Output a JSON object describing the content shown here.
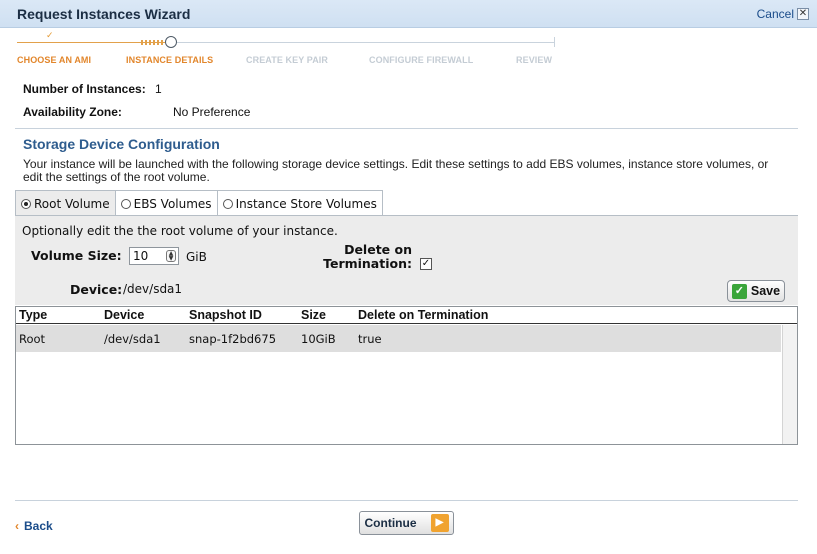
{
  "window": {
    "title": "Request Instances Wizard",
    "cancel_label": "Cancel",
    "cancel_icon": "close-icon"
  },
  "steps": [
    {
      "label": "CHOOSE AN AMI",
      "state": "done"
    },
    {
      "label": "INSTANCE DETAILS",
      "state": "active"
    },
    {
      "label": "CREATE KEY PAIR",
      "state": "pending"
    },
    {
      "label": "CONFIGURE FIREWALL",
      "state": "pending"
    },
    {
      "label": "REVIEW",
      "state": "pending"
    }
  ],
  "instance": {
    "count_label": "Number of Instances:",
    "count_value": "1",
    "zone_label": "Availability Zone:",
    "zone_value": "No Preference"
  },
  "storage": {
    "title": "Storage Device Configuration",
    "description": "Your instance will be launched with the following storage device settings. Edit these settings to add EBS volumes, instance store volumes, or edit the settings of the root volume.",
    "tabs": [
      {
        "label": "Root Volume",
        "selected": true
      },
      {
        "label": "EBS Volumes",
        "selected": false
      },
      {
        "label": "Instance Store Volumes",
        "selected": false
      }
    ],
    "hint": "Optionally edit the the root volume of your instance.",
    "volume_size_label": "Volume Size:",
    "volume_size_value": "10",
    "volume_size_unit": "GiB",
    "delete_label": "Delete on Termination:",
    "delete_checked": true,
    "device_label": "Device:",
    "device_value": "/dev/sda1",
    "save_label": "Save"
  },
  "table": {
    "columns": [
      "Type",
      "Device",
      "Snapshot ID",
      "Size",
      "Delete on Termination"
    ],
    "rows": [
      [
        "Root",
        "/dev/sda1",
        "snap-1f2bd675",
        "10GiB",
        "true"
      ]
    ]
  },
  "footer": {
    "back_label": "Back",
    "continue_label": "Continue"
  },
  "colors": {
    "accent_orange": "#e2862b",
    "title_blue": "#2e5c8e",
    "link_blue": "#1a4c8a",
    "save_green": "#3aa53a"
  }
}
